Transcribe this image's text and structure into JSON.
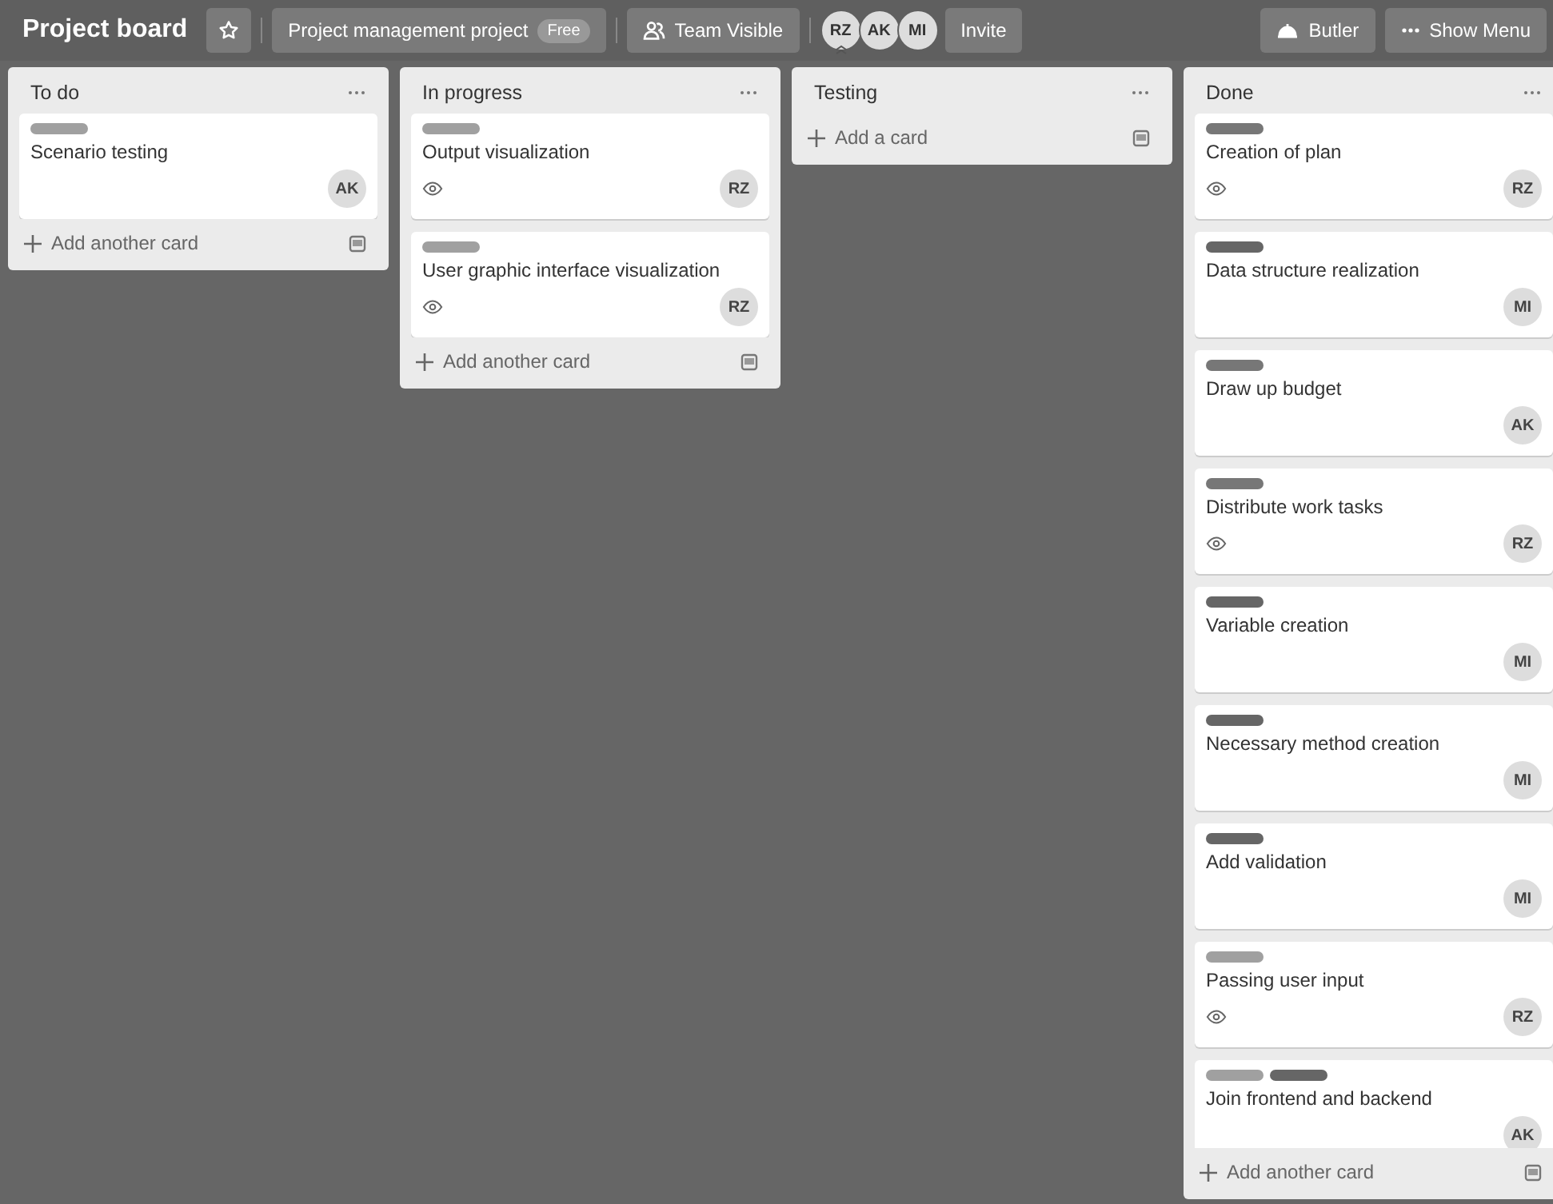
{
  "header": {
    "title": "Project board",
    "board_name": "Project management project",
    "plan_badge": "Free",
    "visibility": "Team Visible",
    "members": [
      {
        "initials": "RZ",
        "admin": true
      },
      {
        "initials": "AK",
        "admin": false
      },
      {
        "initials": "MI",
        "admin": false
      }
    ],
    "invite": "Invite",
    "butler": "Butler",
    "show_menu": "Show Menu"
  },
  "lists": [
    {
      "title": "To do",
      "add_label": "Add another card",
      "cards": [
        {
          "title": "Scenario testing",
          "labels": [
            {
              "color": "#a0a0a0"
            }
          ],
          "watched": false,
          "member": "AK"
        }
      ]
    },
    {
      "title": "In progress",
      "add_label": "Add another card",
      "cards": [
        {
          "title": "Output visualization",
          "labels": [
            {
              "color": "#a0a0a0"
            }
          ],
          "watched": true,
          "member": "RZ"
        },
        {
          "title": "User graphic interface visualization",
          "labels": [
            {
              "color": "#a0a0a0"
            }
          ],
          "watched": true,
          "member": "RZ"
        }
      ]
    },
    {
      "title": "Testing",
      "add_label": "Add a card"
    },
    {
      "title": "Done",
      "add_label": "Add another card",
      "cards": [
        {
          "title": "Creation of plan",
          "labels": [
            {
              "color": "#777777"
            }
          ],
          "watched": true,
          "member": "RZ"
        },
        {
          "title": "Data structure realization",
          "labels": [
            {
              "color": "#666666"
            }
          ],
          "watched": false,
          "member": "MI"
        },
        {
          "title": "Draw up budget",
          "labels": [
            {
              "color": "#777777"
            }
          ],
          "watched": false,
          "member": "AK"
        },
        {
          "title": "Distribute work tasks",
          "labels": [
            {
              "color": "#777777"
            }
          ],
          "watched": true,
          "member": "RZ"
        },
        {
          "title": "Variable creation",
          "labels": [
            {
              "color": "#666666"
            }
          ],
          "watched": false,
          "member": "MI"
        },
        {
          "title": "Necessary method creation",
          "labels": [
            {
              "color": "#666666"
            }
          ],
          "watched": false,
          "member": "MI"
        },
        {
          "title": "Add validation",
          "labels": [
            {
              "color": "#666666"
            }
          ],
          "watched": false,
          "member": "MI"
        },
        {
          "title": "Passing user input",
          "labels": [
            {
              "color": "#a0a0a0"
            }
          ],
          "watched": true,
          "member": "RZ"
        },
        {
          "title": "Join frontend and backend",
          "labels": [
            {
              "color": "#a0a0a0"
            },
            {
              "color": "#666666"
            }
          ],
          "watched": false,
          "member": "AK"
        }
      ]
    }
  ]
}
